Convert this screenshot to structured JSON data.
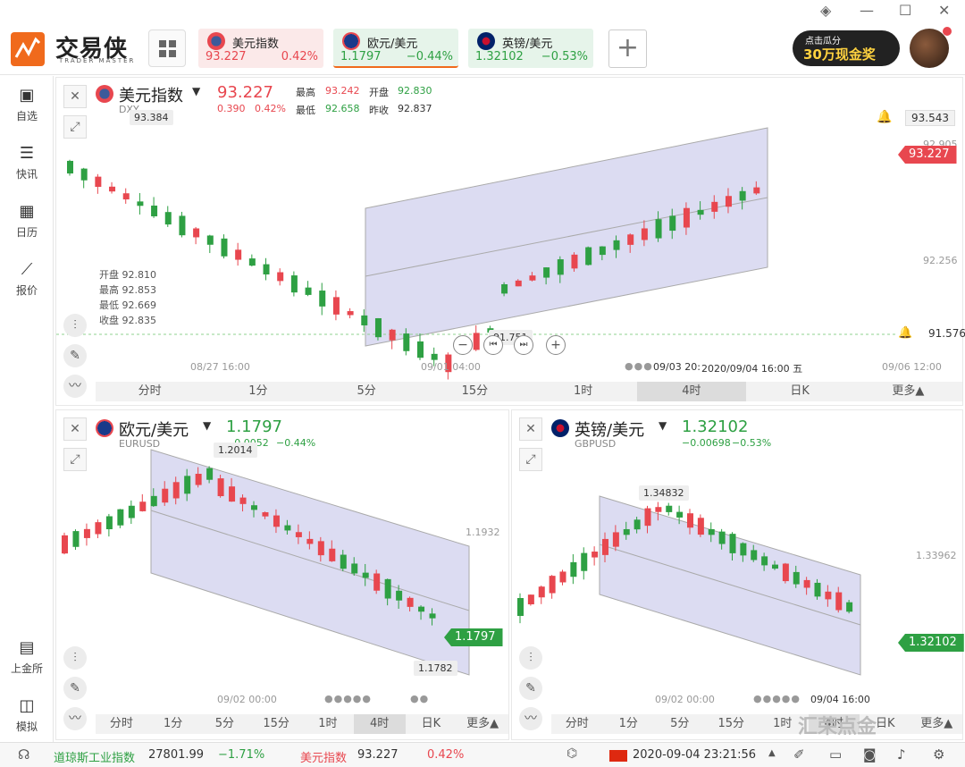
{
  "app": {
    "name": "交易侠",
    "subtitle": "TRADER MASTER"
  },
  "tickers": [
    {
      "name": "美元指数",
      "price": "93.227",
      "change": "0.42%",
      "color": "#e8474f",
      "bg": "#fbe9e9"
    },
    {
      "name": "欧元/美元",
      "price": "1.1797",
      "change": "−0.44%",
      "color": "#2ea043",
      "bg": "#e6f4ea"
    },
    {
      "name": "英镑/美元",
      "price": "1.32102",
      "change": "−0.53%",
      "color": "#2ea043",
      "bg": "#e6f4ea"
    }
  ],
  "add_label": "+",
  "promo": {
    "line1": "点击瓜分",
    "line2": "30万现金奖"
  },
  "sidebar": [
    {
      "label": "自选",
      "icon": "bookmark-icon"
    },
    {
      "label": "快讯",
      "icon": "news-icon"
    },
    {
      "label": "日历",
      "icon": "calendar-icon"
    },
    {
      "label": "报价",
      "icon": "chart-line-icon"
    },
    {
      "label": "上金所",
      "icon": "exchange-icon"
    },
    {
      "label": "模拟",
      "icon": "wallet-icon"
    }
  ],
  "main_chart": {
    "title": "美元指数",
    "code": "DXY",
    "price": "93.227",
    "chg": "0.390",
    "chg_pct": "0.42%",
    "high_label": "最高",
    "high": "93.242",
    "open_label": "开盘",
    "open": "92.830",
    "low_label": "最低",
    "low": "92.658",
    "prev_label": "昨收",
    "prev": "92.837",
    "ohlc": [
      "开盘 92.810",
      "最高 92.853",
      "最低 92.669",
      "收盘 92.835"
    ],
    "hi_marker": "93.384",
    "lo_marker": "91.751",
    "alert_top": "93.543",
    "alert_bottom": "91.576",
    "price_tag": "93.227",
    "axis_y": [
      "92.905",
      "92.256"
    ],
    "axis_x": [
      "08/27 16:00",
      "09/01 04:00",
      "09/03 20:",
      "2020/09/04 16:00 五",
      "09/06 12:00"
    ],
    "timeframes": [
      "分时",
      "1分",
      "5分",
      "15分",
      "1时",
      "4时",
      "日K",
      "更多▲"
    ],
    "selected_tf": "4时"
  },
  "eur_chart": {
    "title": "欧元/美元",
    "code": "EURUSD",
    "price": "1.1797",
    "chg": "−0.0052",
    "chg_pct": "−0.44%",
    "hi_marker": "1.2014",
    "lo_marker": "1.1782",
    "axis_y": "1.1932",
    "price_tag": "1.1797",
    "axis_x": "09/02 00:00",
    "timeframes": [
      "分时",
      "1分",
      "5分",
      "15分",
      "1时",
      "4时",
      "日K",
      "更多▲"
    ],
    "selected_tf": "4时"
  },
  "gbp_chart": {
    "title": "英镑/美元",
    "code": "GBPUSD",
    "price": "1.32102",
    "chg": "−0.00698",
    "chg_pct": "−0.53%",
    "hi_marker": "1.34832",
    "axis_y": "1.33962",
    "price_tag": "1.32102",
    "axis_x": [
      "09/02 00:00",
      "09/04 16:00"
    ],
    "timeframes": [
      "分时",
      "1分",
      "5分",
      "15分",
      "1时",
      "4时",
      "日K",
      "更多▲"
    ],
    "selected_tf": "4时"
  },
  "bottom": {
    "idx1_name": "道琼斯工业指数",
    "idx1_val": "27801.99",
    "idx1_chg": "−1.71%",
    "idx2_name": "美元指数",
    "idx2_val": "93.227",
    "idx2_chg": "0.42%",
    "datetime": "2020-09-04 23:21:56",
    "watermark": "汇荣点金"
  },
  "colors": {
    "up": "#e8474f",
    "down": "#2ea043",
    "channel": "#d8d8f0"
  }
}
